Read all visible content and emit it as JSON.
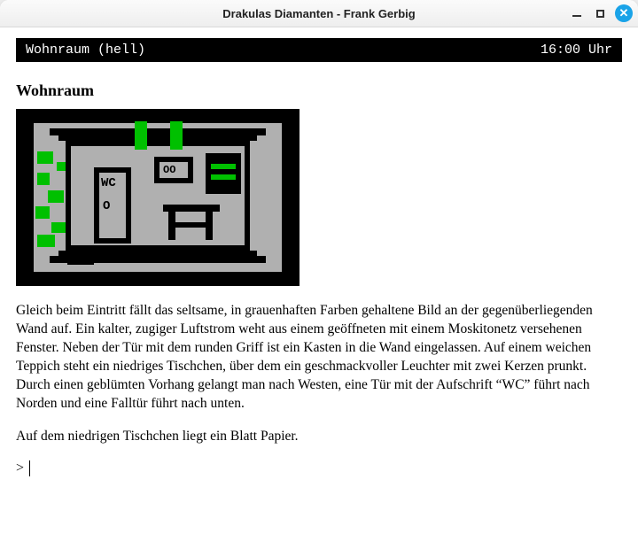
{
  "window": {
    "title": "Drakulas Diamanten - Frank Gerbig"
  },
  "statusbar": {
    "location": "Wohnraum (hell)",
    "time": "16:00 Uhr"
  },
  "room": {
    "title": "Wohnraum"
  },
  "scene": {
    "door_label": "WC",
    "door_knob": "O",
    "picture_dots": "OO"
  },
  "description": {
    "para1": "Gleich beim Eintritt fällt das seltsame, in grauenhaften Farben gehaltene Bild an der gegenüberliegenden Wand auf. Ein kalter, zugiger Luftstrom weht aus einem geöffneten mit einem Moskitonetz versehenen Fenster. Neben der Tür mit dem runden Griff ist ein Kasten in die Wand eingelassen. Auf einem weichen Teppich steht ein niedriges Tischchen, über dem ein geschmackvoller Leuchter mit zwei Kerzen prunkt. Durch einen geblümten Vorhang gelangt man nach Westen, eine Tür mit der Aufschrift “WC” führt nach Norden und eine Falltür führt nach unten.",
    "para2": "Auf dem niedrigen Tischchen liegt ein Blatt Papier."
  },
  "prompt": {
    "symbol": ">",
    "value": ""
  },
  "colors": {
    "accent_green": "#00c000",
    "grey": "#b0b0b0",
    "close_btn": "#1aa3e8"
  }
}
